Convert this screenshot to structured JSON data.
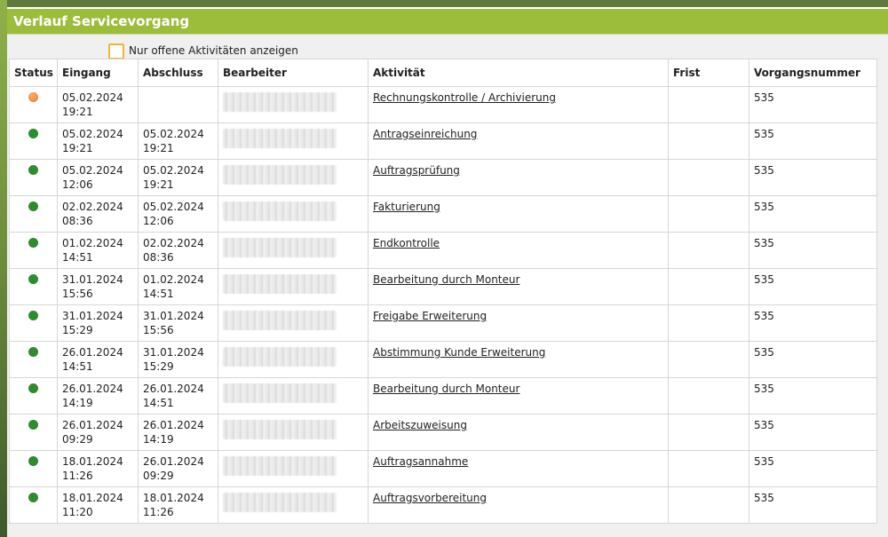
{
  "panel": {
    "title": "Verlauf Servicevorgang",
    "filter_label": "Nur offene Aktivitäten anzeigen",
    "filter_checked": false
  },
  "colors": {
    "header_bg": "#9cbc3c",
    "checkbox_border": "#f3b533",
    "status_done": "#2e8b2e",
    "status_open": "#e8782a"
  },
  "table": {
    "headers": [
      "Status",
      "Eingang",
      "Abschluss",
      "Bearbeiter",
      "Aktivität",
      "Frist",
      "Vorgangsnummer"
    ],
    "rows": [
      {
        "status": "open",
        "eingang_date": "05.02.2024",
        "eingang_time": "19:21",
        "abschluss_date": "",
        "abschluss_time": "",
        "aktivitaet": "Rechnungskontrolle / Archivierung",
        "frist": "",
        "vorgangsnummer": "535"
      },
      {
        "status": "done",
        "eingang_date": "05.02.2024",
        "eingang_time": "19:21",
        "abschluss_date": "05.02.2024",
        "abschluss_time": "19:21",
        "aktivitaet": "Antragseinreichung",
        "frist": "",
        "vorgangsnummer": "535"
      },
      {
        "status": "done",
        "eingang_date": "05.02.2024",
        "eingang_time": "12:06",
        "abschluss_date": "05.02.2024",
        "abschluss_time": "19:21",
        "aktivitaet": "Auftragsprüfung",
        "frist": "",
        "vorgangsnummer": "535"
      },
      {
        "status": "done",
        "eingang_date": "02.02.2024",
        "eingang_time": "08:36",
        "abschluss_date": "05.02.2024",
        "abschluss_time": "12:06",
        "aktivitaet": "Fakturierung",
        "frist": "",
        "vorgangsnummer": "535"
      },
      {
        "status": "done",
        "eingang_date": "01.02.2024",
        "eingang_time": "14:51",
        "abschluss_date": "02.02.2024",
        "abschluss_time": "08:36",
        "aktivitaet": "Endkontrolle",
        "frist": "",
        "vorgangsnummer": "535"
      },
      {
        "status": "done",
        "eingang_date": "31.01.2024",
        "eingang_time": "15:56",
        "abschluss_date": "01.02.2024",
        "abschluss_time": "14:51",
        "aktivitaet": "Bearbeitung durch Monteur",
        "frist": "",
        "vorgangsnummer": "535"
      },
      {
        "status": "done",
        "eingang_date": "31.01.2024",
        "eingang_time": "15:29",
        "abschluss_date": "31.01.2024",
        "abschluss_time": "15:56",
        "aktivitaet": "Freigabe Erweiterung",
        "frist": "",
        "vorgangsnummer": "535"
      },
      {
        "status": "done",
        "eingang_date": "26.01.2024",
        "eingang_time": "14:51",
        "abschluss_date": "31.01.2024",
        "abschluss_time": "15:29",
        "aktivitaet": "Abstimmung Kunde Erweiterung",
        "frist": "",
        "vorgangsnummer": "535"
      },
      {
        "status": "done",
        "eingang_date": "26.01.2024",
        "eingang_time": "14:19",
        "abschluss_date": "26.01.2024",
        "abschluss_time": "14:51",
        "aktivitaet": "Bearbeitung durch Monteur",
        "frist": "",
        "vorgangsnummer": "535"
      },
      {
        "status": "done",
        "eingang_date": "26.01.2024",
        "eingang_time": "09:29",
        "abschluss_date": "26.01.2024",
        "abschluss_time": "14:19",
        "aktivitaet": "Arbeitszuweisung",
        "frist": "",
        "vorgangsnummer": "535"
      },
      {
        "status": "done",
        "eingang_date": "18.01.2024",
        "eingang_time": "11:26",
        "abschluss_date": "26.01.2024",
        "abschluss_time": "09:29",
        "aktivitaet": "Auftragsannahme",
        "frist": "",
        "vorgangsnummer": "535"
      },
      {
        "status": "done",
        "eingang_date": "18.01.2024",
        "eingang_time": "11:20",
        "abschluss_date": "18.01.2024",
        "abschluss_time": "11:26",
        "aktivitaet": "Auftragsvorbereitung",
        "frist": "",
        "vorgangsnummer": "535"
      }
    ]
  }
}
